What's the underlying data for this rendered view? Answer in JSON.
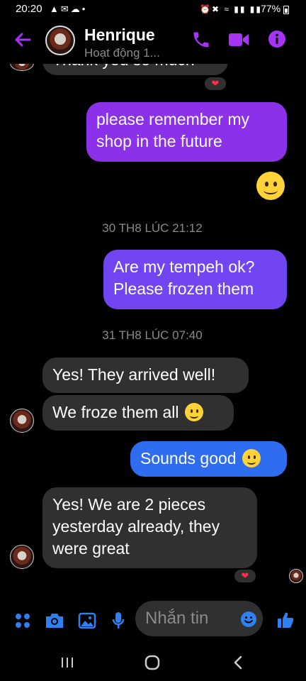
{
  "status_bar": {
    "time": "20:20",
    "battery": "77%"
  },
  "header": {
    "name": "Henrique",
    "status": "Hoạt động 1..."
  },
  "messages": {
    "partial_top": "Thank you so much",
    "m1": "please remember my shop in the future",
    "ts1": "30 TH8 LÚC 21:12",
    "m2_line1": "Are my tempeh ok?",
    "m2_line2": "Please frozen them",
    "ts2": "31 TH8 LÚC 07:40",
    "m3": "Yes! They arrived well!",
    "m4": "We froze them all",
    "m5": "Sounds good",
    "m6_line1": "Yes! We are 2 pieces",
    "m6_line2": "yesterday already, they",
    "m6_line3": "were great",
    "reaction": "❤"
  },
  "composer": {
    "placeholder": "Nhắn tin"
  },
  "colors": {
    "accent": "#a534f5",
    "bubble_incoming": "#303030",
    "bubble_purple": "#8a31e9",
    "bubble_violet": "#7146f2",
    "bubble_blue": "#2f6df0",
    "composer_icons": "#2f80f0"
  },
  "icons": [
    "back-arrow-icon",
    "phone-icon",
    "video-icon",
    "info-icon",
    "apps-icon",
    "camera-icon",
    "gallery-icon",
    "mic-icon",
    "emoji-icon",
    "thumbs-up-icon",
    "recents-icon",
    "home-icon",
    "nav-back-icon"
  ]
}
